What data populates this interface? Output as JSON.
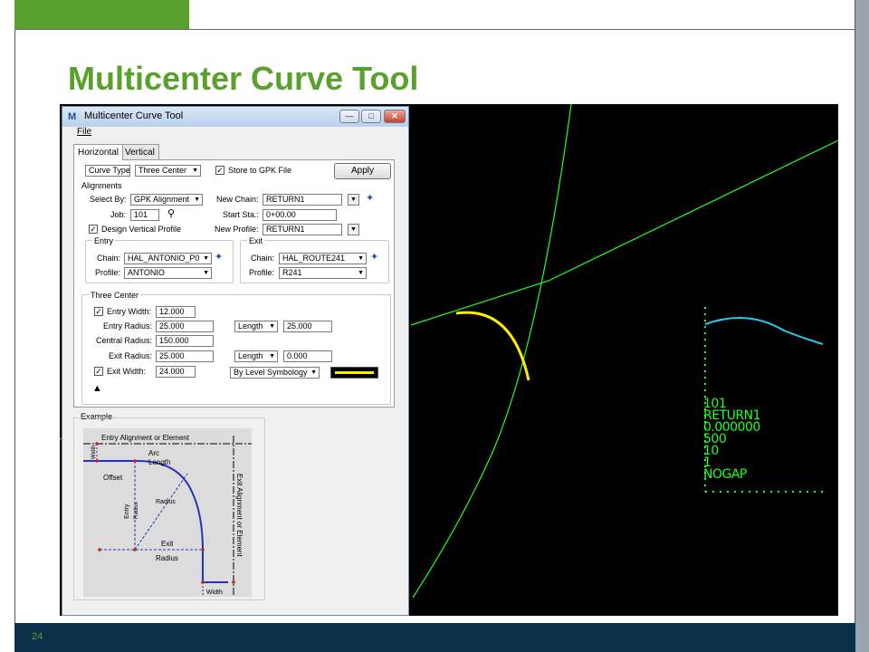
{
  "slide": {
    "title": "Multicenter Curve Tool",
    "page_number": "24",
    "accent_color": "#5aa02c",
    "footer_color": "#0b304b"
  },
  "dialog": {
    "app_icon": "M",
    "title": "Multicenter Curve Tool",
    "window_buttons": {
      "minimize": "minimize-icon",
      "maximize": "maximize-icon",
      "close": "close-icon"
    },
    "menu": [
      "File"
    ],
    "tabs": [
      "Horizontal",
      "Vertical"
    ],
    "curve_type": {
      "label": "Curve Type:",
      "value": "Three Center"
    },
    "store_to_gpk": {
      "label": "Store to GPK File",
      "checked": true
    },
    "apply_label": "Apply",
    "alignments": {
      "group_label": "Alignments",
      "select_by_label": "Select By:",
      "select_by_value": "GPK Alignment",
      "job_label": "Job:",
      "job_value": "101",
      "design_vertical_profile_label": "Design Vertical Profile",
      "design_vertical_profile_checked": true,
      "new_chain_label": "New Chain:",
      "new_chain_value": "RETURN1",
      "start_sta_label": "Start Sta.:",
      "start_sta_value": "0+00.00",
      "new_profile_label": "New Profile:",
      "new_profile_value": "RETURN1"
    },
    "entry": {
      "group_label": "Entry",
      "chain_label": "Chain:",
      "chain_value": "HAL_ANTONIO_P0",
      "profile_label": "Profile:",
      "profile_value": "ANTONIO"
    },
    "exit": {
      "group_label": "Exit",
      "chain_label": "Chain:",
      "chain_value": "HAL_ROUTE241",
      "profile_label": "Profile:",
      "profile_value": "R241"
    },
    "three_center": {
      "group_label": "Three Center",
      "entry_width_label": "Entry Width:",
      "entry_width_value": "12.000",
      "entry_width_checked": true,
      "entry_radius_label": "Entry Radius:",
      "entry_radius_value": "25.000",
      "entry_length_type": "Length",
      "entry_length_value": "25.000",
      "central_radius_label": "Central Radius:",
      "central_radius_value": "150.000",
      "exit_radius_label": "Exit Radius:",
      "exit_radius_value": "25.000",
      "exit_length_type": "Length",
      "exit_length_value": "0.000",
      "exit_width_label": "Exit Width:",
      "exit_width_value": "24.000",
      "exit_width_checked": true,
      "symbology_value": "By Level Symbology",
      "line_color_swatch": "#ffee00",
      "collapse_glyph": "▲"
    },
    "example": {
      "group_label": "Example",
      "entry_alignment": "Entry Alignment or Element",
      "exit_alignment": "Exit Alignment or Element",
      "width_top": "Width",
      "arc": "Arc",
      "length": "Length",
      "offset": "Offset",
      "entry": "Entry",
      "radius_vertical": "Radius",
      "radius_center": "Radius",
      "exit": "Exit",
      "radius_bottom": "Radius",
      "width_bottom": "Width"
    }
  },
  "cad": {
    "background": "#000000",
    "line_color": "#22ff22",
    "curve_color": "#ffee00",
    "profile_color": "#22ccee",
    "info_lines": [
      "101",
      "RETURN1",
      "0.000000",
      "500",
      "10",
      "1",
      "NOGAP"
    ]
  }
}
